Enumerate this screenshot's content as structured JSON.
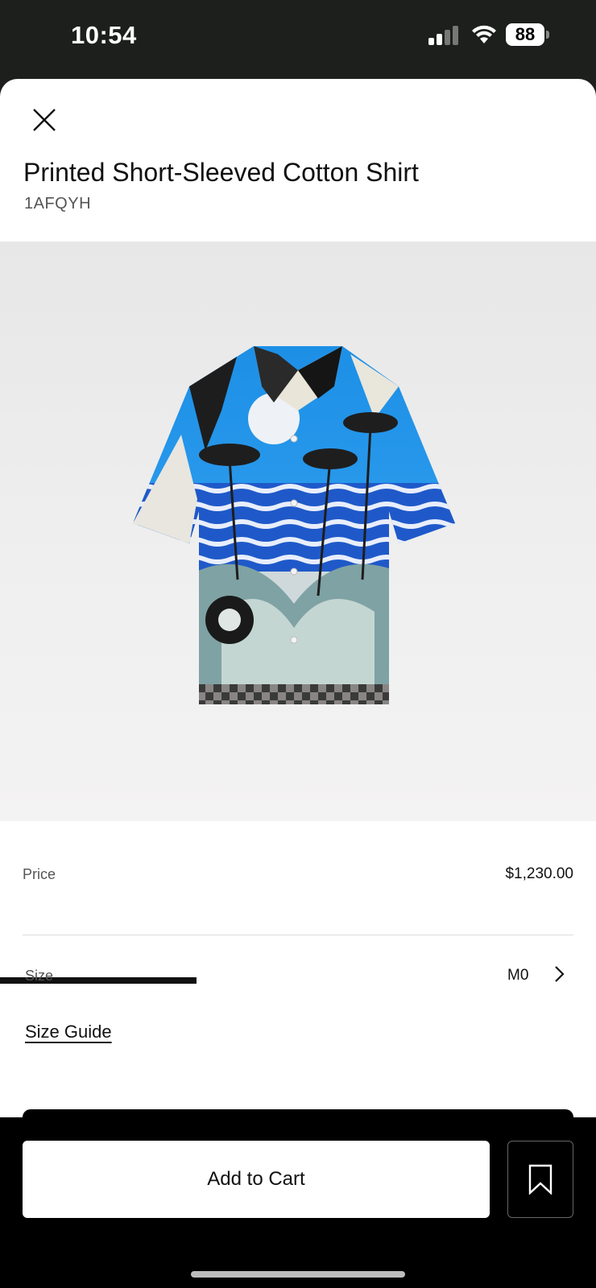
{
  "status_bar": {
    "time": "10:54",
    "battery": "88",
    "icons": [
      "cellular-signal-icon",
      "wifi-icon",
      "battery-icon"
    ]
  },
  "header": {
    "close_icon": "close-icon",
    "title": "Printed Short-Sleeved Cotton Shirt",
    "sku": "1AFQYH"
  },
  "gallery": {
    "image_alt": "shirt-product-image",
    "progress": 0.33
  },
  "details": {
    "price_label": "Price",
    "price_value": "$1,230.00",
    "size_label": "Size",
    "size_value": "M0",
    "size_guide": "Size Guide"
  },
  "actions": {
    "add_to_cart": "Add to Cart",
    "wishlist_icon": "bookmark-icon"
  },
  "colors": {
    "accent": "#000000",
    "background": "#ffffff",
    "status_bar": "#1d1f1c"
  }
}
